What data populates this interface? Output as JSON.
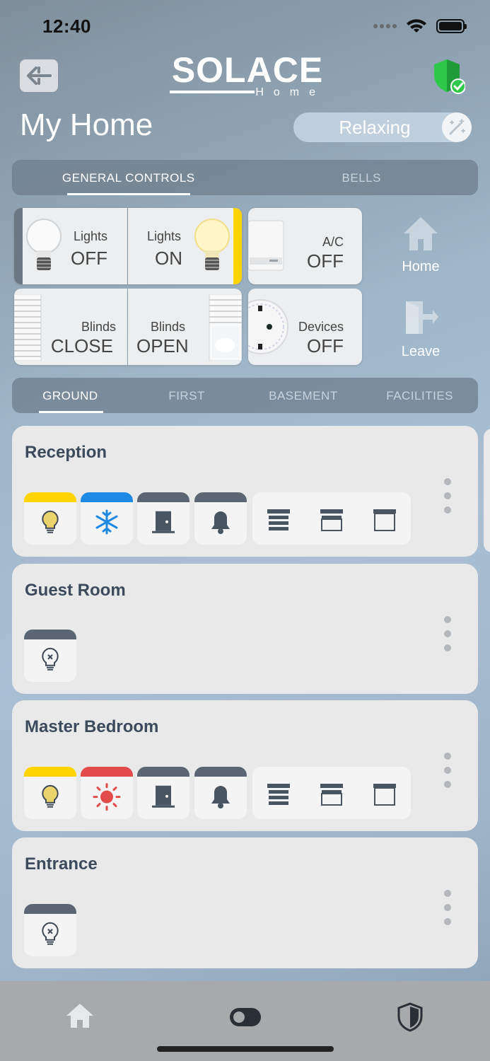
{
  "status_bar": {
    "time": "12:40"
  },
  "header": {
    "logo_text": "SOLACE",
    "logo_subtext": "Home",
    "title": "My Home",
    "scene": "Relaxing"
  },
  "main_tabs": [
    {
      "label": "GENERAL CONTROLS",
      "active": true
    },
    {
      "label": "BELLS",
      "active": false
    }
  ],
  "general_controls": {
    "lights_off": {
      "label": "Lights",
      "value": "OFF"
    },
    "lights_on": {
      "label": "Lights",
      "value": "ON"
    },
    "ac": {
      "label": "A/C",
      "value": "OFF"
    },
    "blinds_close": {
      "label": "Blinds",
      "value": "CLOSE"
    },
    "blinds_open": {
      "label": "Blinds",
      "value": "OPEN"
    },
    "devices": {
      "label": "Devices",
      "value": "OFF"
    },
    "home_action": "Home",
    "leave_action": "Leave"
  },
  "floor_tabs": [
    {
      "label": "GROUND",
      "active": true
    },
    {
      "label": "FIRST",
      "active": false
    },
    {
      "label": "BASEMENT",
      "active": false
    },
    {
      "label": "FACILITIES",
      "active": false
    }
  ],
  "rooms": [
    {
      "name": "Reception"
    },
    {
      "name": "Guest Room"
    },
    {
      "name": "Master Bedroom"
    },
    {
      "name": "Entrance"
    }
  ],
  "colors": {
    "light_on": "#ffd400",
    "ac_cool": "#1e88e5",
    "ac_heat": "#e34b4b",
    "neutral_cap": "#5b6672",
    "icon": "#5b6672",
    "shield_green": "#2ec84a"
  },
  "icons": {
    "back": "back-arrow-icon",
    "shield": "security-shield-check-icon",
    "scene": "magic-wand-icon",
    "nav_home": "home-icon",
    "nav_toggle": "toggle-icon",
    "nav_security": "shield-icon"
  }
}
